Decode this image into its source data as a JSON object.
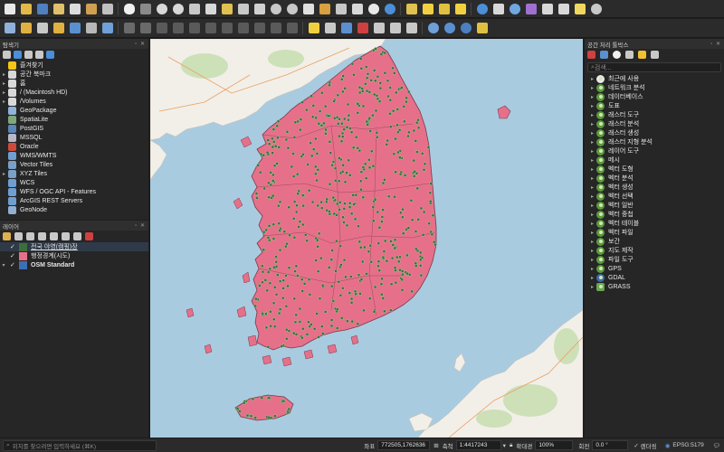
{
  "browser": {
    "title": "탐색기",
    "items": [
      {
        "label": "즐겨찾기",
        "icon": "star-icon",
        "color": "#f5c518",
        "arrow": ""
      },
      {
        "label": "공간 북마크",
        "icon": "bookmark-icon",
        "color": "#d8d8d8",
        "arrow": "▸"
      },
      {
        "label": "홈",
        "icon": "folder-icon",
        "color": "#d9d9d9",
        "arrow": "▸"
      },
      {
        "label": "/ (Macintosh HD)",
        "icon": "folder-icon",
        "color": "#d9d9d9",
        "arrow": "▸"
      },
      {
        "label": "/Volumes",
        "icon": "folder-icon",
        "color": "#d9d9d9",
        "arrow": "▸"
      },
      {
        "label": "GeoPackage",
        "icon": "geopackage-icon",
        "color": "#8fb3d9",
        "arrow": ""
      },
      {
        "label": "SpatiaLite",
        "icon": "spatialite-icon",
        "color": "#7fa87a",
        "arrow": ""
      },
      {
        "label": "PostGIS",
        "icon": "postgis-icon",
        "color": "#5a86b8",
        "arrow": ""
      },
      {
        "label": "MSSQL",
        "icon": "mssql-icon",
        "color": "#b8b8c8",
        "arrow": ""
      },
      {
        "label": "Oracle",
        "icon": "oracle-icon",
        "color": "#d04a3a",
        "arrow": ""
      },
      {
        "label": "WMS/WMTS",
        "icon": "globe-icon",
        "color": "#6f9fd0",
        "arrow": ""
      },
      {
        "label": "Vector Tiles",
        "icon": "vector-tiles-icon",
        "color": "#7aa0c8",
        "arrow": ""
      },
      {
        "label": "XYZ Tiles",
        "icon": "xyz-tiles-icon",
        "color": "#7aa0c8",
        "arrow": "▸"
      },
      {
        "label": "WCS",
        "icon": "globe-icon",
        "color": "#6f9fd0",
        "arrow": ""
      },
      {
        "label": "WFS / OGC API - Features",
        "icon": "globe-icon",
        "color": "#6f9fd0",
        "arrow": ""
      },
      {
        "label": "ArcGIS REST Servers",
        "icon": "arcgis-icon",
        "color": "#6f9fd0",
        "arrow": ""
      },
      {
        "label": "GeoNode",
        "icon": "geonode-icon",
        "color": "#8fb0d0",
        "arrow": ""
      }
    ]
  },
  "layers": {
    "title": "레이어",
    "items": [
      {
        "label": "전국 야영(캠핑)장",
        "swatch": "#3c6e3c",
        "kind": "point",
        "checked": "✓",
        "arrow": "",
        "bold": false
      },
      {
        "label": "행정경계(시도)",
        "swatch": "#e6708a",
        "kind": "polygon",
        "checked": "✓",
        "arrow": "",
        "bold": false
      },
      {
        "label": "OSM Standard",
        "swatch": "#3b6fb6",
        "kind": "raster",
        "checked": "✓",
        "arrow": "▾",
        "bold": true
      }
    ]
  },
  "processing": {
    "title": "공간 처리 툴박스",
    "search_placeholder": "검색...",
    "items": [
      {
        "label": "최근에 사용",
        "icon": "clock-icon"
      },
      {
        "label": "네트워크 분석",
        "icon": "qgis-icon"
      },
      {
        "label": "데이터베이스",
        "icon": "qgis-icon"
      },
      {
        "label": "도표",
        "icon": "qgis-icon"
      },
      {
        "label": "래스터 도구",
        "icon": "qgis-icon"
      },
      {
        "label": "래스터 분석",
        "icon": "qgis-icon"
      },
      {
        "label": "래스터 생성",
        "icon": "qgis-icon"
      },
      {
        "label": "래스터 지형 분석",
        "icon": "qgis-icon"
      },
      {
        "label": "레이어 도구",
        "icon": "qgis-icon"
      },
      {
        "label": "메시",
        "icon": "qgis-icon"
      },
      {
        "label": "벡터 도형",
        "icon": "qgis-icon"
      },
      {
        "label": "벡터 분석",
        "icon": "qgis-icon"
      },
      {
        "label": "벡터 생성",
        "icon": "qgis-icon"
      },
      {
        "label": "벡터 선택",
        "icon": "qgis-icon"
      },
      {
        "label": "벡터 일반",
        "icon": "qgis-icon"
      },
      {
        "label": "벡터 중첩",
        "icon": "qgis-icon"
      },
      {
        "label": "벡터 테이블",
        "icon": "qgis-icon"
      },
      {
        "label": "벡터 파일",
        "icon": "qgis-icon"
      },
      {
        "label": "보간",
        "icon": "qgis-icon"
      },
      {
        "label": "지도 제작",
        "icon": "qgis-icon"
      },
      {
        "label": "파일 도구",
        "icon": "qgis-icon"
      },
      {
        "label": "GPS",
        "icon": "qgis-icon"
      },
      {
        "label": "GDAL",
        "icon": "gdal-icon"
      },
      {
        "label": "GRASS",
        "icon": "grass-icon"
      }
    ]
  },
  "statusbar": {
    "locator_placeholder": "위치를 찾으려면 입력하세요 (⌘K)",
    "coord_label": "좌표",
    "coord_value": "772505,1762636",
    "scale_label": "축척",
    "scale_value": "1:4417243",
    "magnifier_label": "확대경",
    "magnifier_value": "100%",
    "rotation_label": "회전",
    "rotation_value": "0.0 °",
    "render_label": "렌더링",
    "crs_value": "EPSG:5179"
  },
  "colors": {
    "land": "#e6708a",
    "sea": "#a9cbe0",
    "campsite": "#3c6e3c",
    "basemap_land": "#f2efe9"
  }
}
